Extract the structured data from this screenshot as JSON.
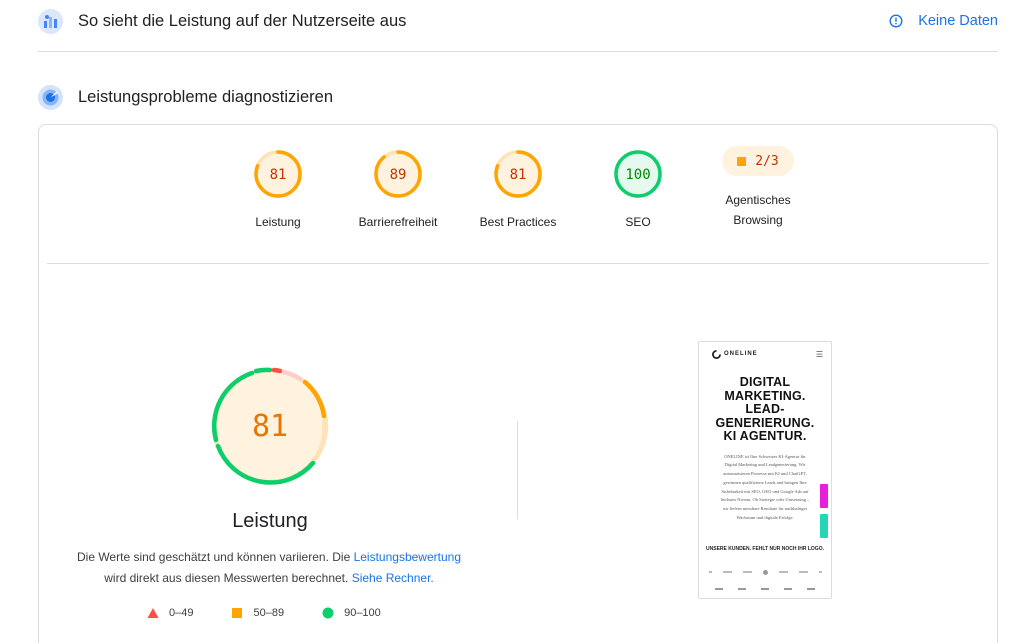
{
  "header_user": {
    "title": "So sieht die Leistung auf der Nutzerseite aus",
    "no_data_label": "Keine Daten",
    "icon": "users-chart-icon"
  },
  "header_diagnose": {
    "title": "Leistungsprobleme diagnostizieren",
    "icon": "lighthouse-icon"
  },
  "categories": [
    {
      "label": "Leistung",
      "score": "81",
      "value": 81,
      "color": "#ffa400",
      "text_color": "#c33300"
    },
    {
      "label": "Barrierefreiheit",
      "score": "89",
      "value": 89,
      "color": "#ffa400",
      "text_color": "#c33300"
    },
    {
      "label": "Best Practices",
      "score": "81",
      "value": 81,
      "color": "#ffa400",
      "text_color": "#c33300"
    },
    {
      "label": "SEO",
      "score": "100",
      "value": 100,
      "color": "#0cce6b",
      "text_color": "#008800"
    }
  ],
  "agentic": {
    "label_line1": "Agentisches",
    "label_line2": "Browsing",
    "value": "2/3"
  },
  "performance": {
    "score": "81",
    "label": "Leistung",
    "desc_part1": "Die Werte sind geschätzt und können variieren. Die ",
    "desc_link1": "Leistungsbewertung",
    "desc_part2": "wird direkt aus diesen Messwerten berechnet. ",
    "desc_link2": "Siehe Rechner."
  },
  "legend": [
    {
      "shape": "triangle",
      "color": "#ff4e42",
      "label": "0–49"
    },
    {
      "shape": "square",
      "color": "#ffa400",
      "label": "50–89"
    },
    {
      "shape": "circle",
      "color": "#0cce6b",
      "label": "90–100"
    }
  ],
  "preview": {
    "logo": "ONELINE",
    "headline_lines": [
      "DIGITAL",
      "MARKETING.",
      "LEAD-",
      "GENERIERUNG.",
      "KI AGENTUR."
    ],
    "body": "ONELINE ist Ihre Schweizer KI-Agentur für Digital Marketing und Leadgenerierung. Wir automatisieren Prozesse mit KI und ChatGPT, gewinnen qualifizierte Leads und bringen Ihre Sichtbarkeit mit SEO, GEO und Google Ads auf höchstes Niveau. Ob Strategie oder Umsetzung – wir liefern messbare Resultate für nachhaltiges Wachstum und digitale Erfolge.",
    "subheadline": "UNSERE KUNDEN. FEHLT NUR NOCH IHR LOGO.",
    "tag_colors": [
      "#e91edb",
      "#24d6b5"
    ]
  }
}
